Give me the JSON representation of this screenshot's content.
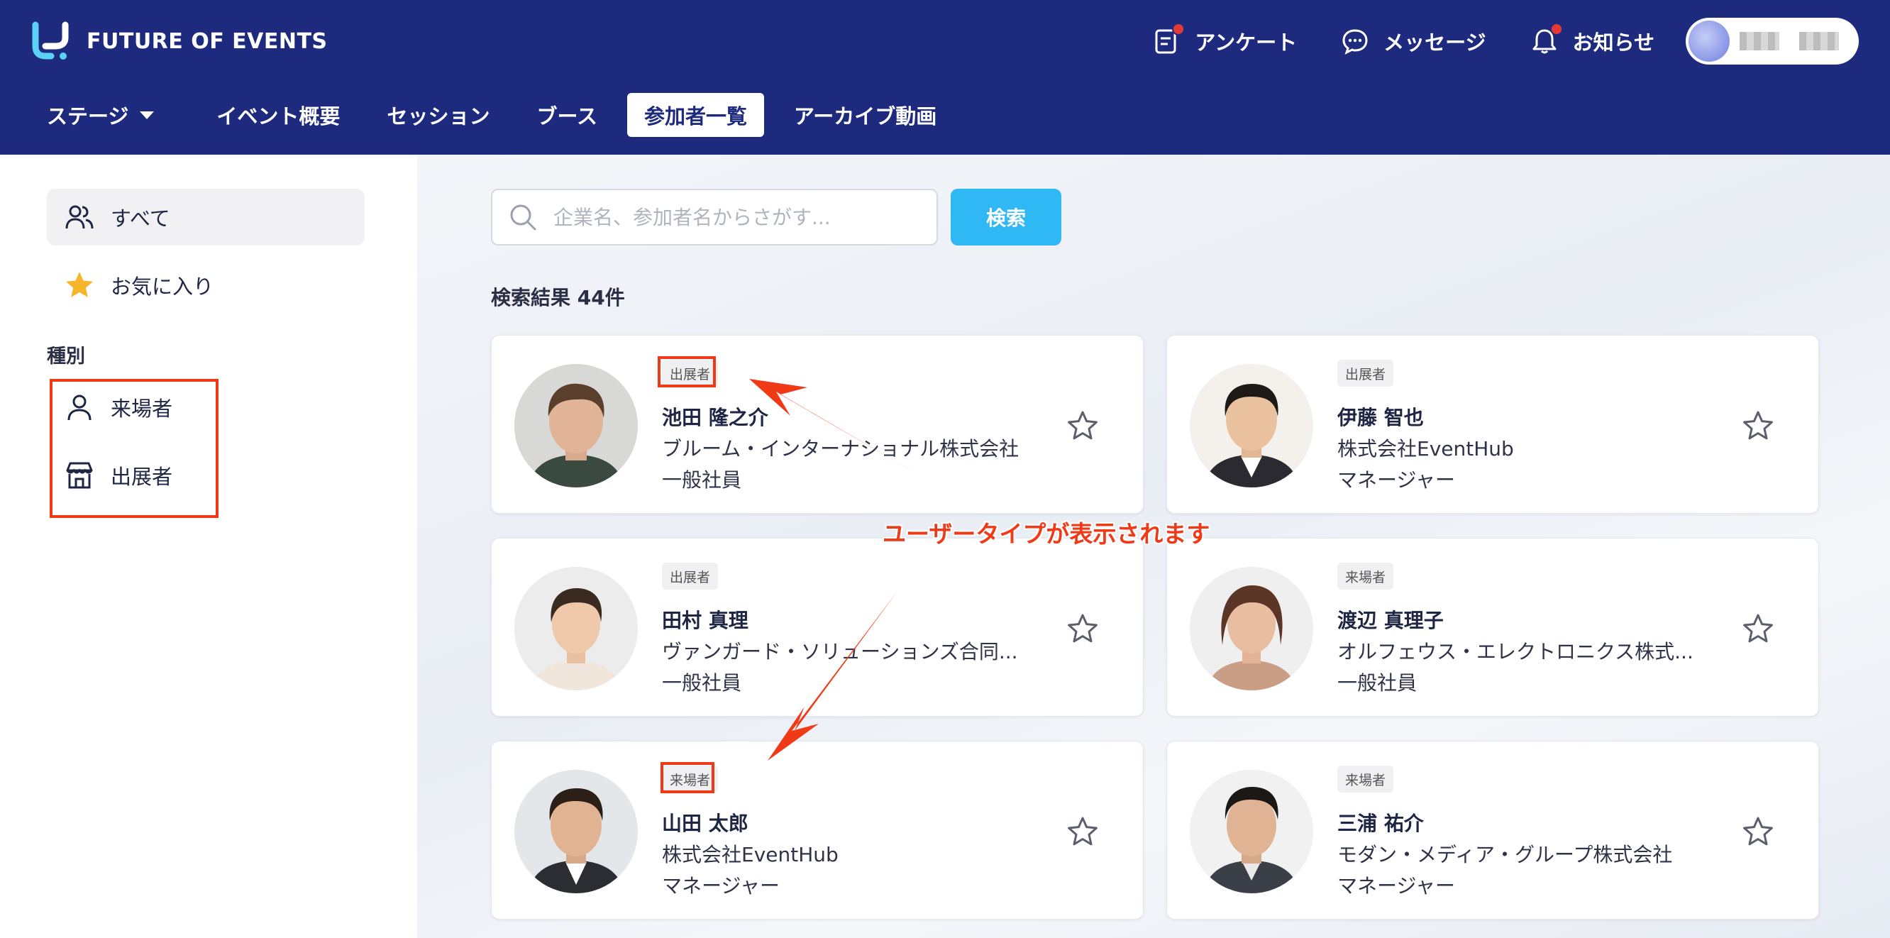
{
  "app": {
    "brand": "FUTURE OF EVENTS"
  },
  "header": {
    "actions": [
      {
        "label": "アンケート",
        "icon": "survey-icon",
        "notification": true
      },
      {
        "label": "メッセージ",
        "icon": "message-icon",
        "notification": false
      },
      {
        "label": "お知らせ",
        "icon": "bell-icon",
        "notification": true
      }
    ]
  },
  "nav": {
    "items": [
      {
        "label": "ステージ"
      },
      {
        "label": "イベント概要"
      },
      {
        "label": "セッション"
      },
      {
        "label": "ブース"
      },
      {
        "label": "参加者一覧",
        "active": true
      },
      {
        "label": "アーカイブ動画"
      }
    ]
  },
  "sidebar": {
    "all": "すべて",
    "favorites": "お気に入り",
    "type_heading": "種別",
    "types": [
      "来場者",
      "出展者"
    ]
  },
  "search": {
    "placeholder": "企業名、参加者名からさがす...",
    "button": "検索",
    "result_count": "検索結果 44件"
  },
  "participants": [
    {
      "badge": "出展者",
      "name": "池田 隆之介",
      "company": "ブルーム・インターナショナル株式会社",
      "role": "一般社員"
    },
    {
      "badge": "出展者",
      "name": "伊藤 智也",
      "company": "株式会社EventHub",
      "role": "マネージャー"
    },
    {
      "badge": "出展者",
      "name": "田村 真理",
      "company": "ヴァンガード・ソリューションズ合同...",
      "role": "一般社員"
    },
    {
      "badge": "来場者",
      "name": "渡辺 真理子",
      "company": "オルフェウス・エレクトロニクス株式...",
      "role": "一般社員"
    },
    {
      "badge": "来場者",
      "name": "山田 太郎",
      "company": "株式会社EventHub",
      "role": "マネージャー"
    },
    {
      "badge": "来場者",
      "name": "三浦 祐介",
      "company": "モダン・メディア・グループ株式会社",
      "role": "マネージャー"
    }
  ],
  "annotation": {
    "text": "ユーザータイプが表示されます",
    "color": "#f03a17"
  },
  "colors": {
    "header": "#1e2a7d",
    "accent": "#2fb8f4",
    "annotation": "#f03a17"
  }
}
